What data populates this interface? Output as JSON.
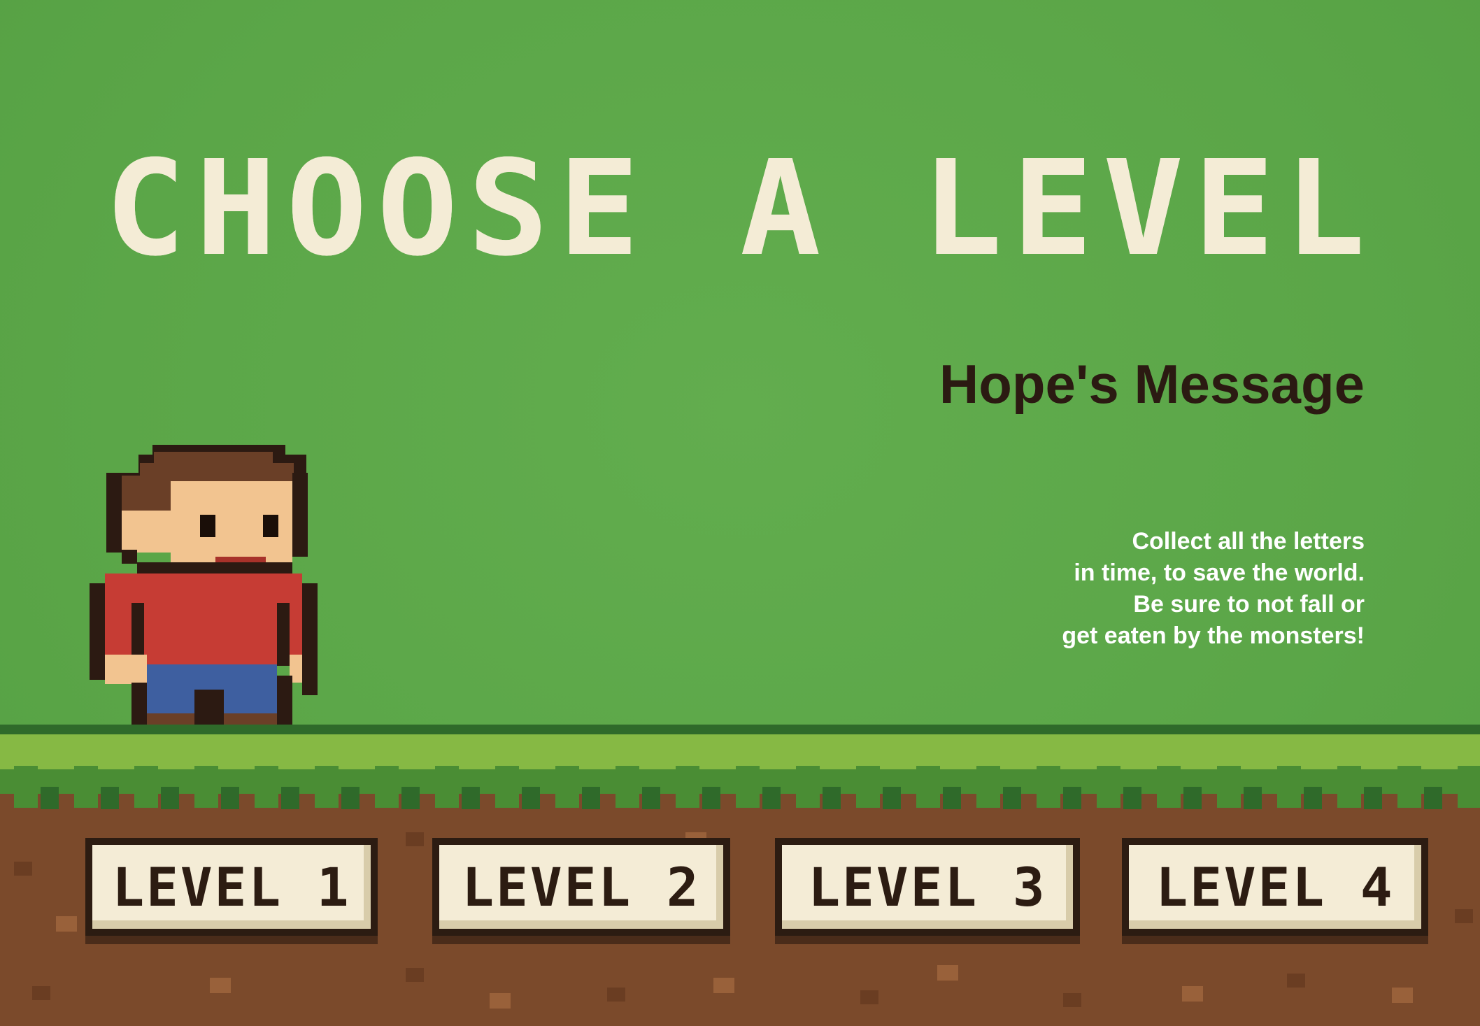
{
  "title": "CHOOSE A LEVEL",
  "message": {
    "heading": "Hope's Message",
    "lines": [
      "Collect all the letters",
      "in time, to save the world.",
      "Be sure to not fall or",
      "get eaten by the monsters!"
    ]
  },
  "levels": [
    {
      "label": "LEVEL 1"
    },
    {
      "label": "LEVEL 2"
    },
    {
      "label": "LEVEL 3"
    },
    {
      "label": "LEVEL 4"
    }
  ],
  "character": {
    "name": "player-character-icon"
  },
  "colors": {
    "sky": "#5da84a",
    "title_text": "#f4ecd6",
    "heading_text": "#2b1a12",
    "message_text": "#ffffff",
    "grass": "#86b944",
    "dirt": "#7b4a2b",
    "button_face": "#f4ecd6",
    "button_border": "#2c1c12"
  }
}
